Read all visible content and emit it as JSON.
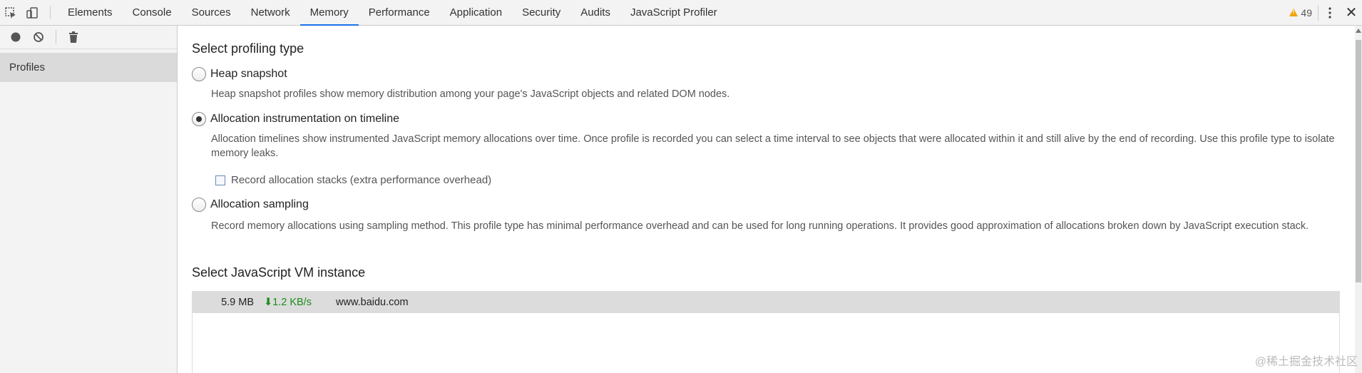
{
  "tabs": [
    "Elements",
    "Console",
    "Sources",
    "Network",
    "Memory",
    "Performance",
    "Application",
    "Security",
    "Audits",
    "JavaScript Profiler"
  ],
  "active_tab": "Memory",
  "warnings_count": "49",
  "sidebar": {
    "item": "Profiles"
  },
  "main": {
    "profiling_heading": "Select profiling type",
    "options": [
      {
        "label": "Heap snapshot",
        "desc": "Heap snapshot profiles show memory distribution among your page's JavaScript objects and related DOM nodes.",
        "selected": false
      },
      {
        "label": "Allocation instrumentation on timeline",
        "desc": "Allocation timelines show instrumented JavaScript memory allocations over time. Once profile is recorded you can select a time interval to see objects that were allocated within it and still alive by the end of recording. Use this profile type to isolate memory leaks.",
        "selected": true
      },
      {
        "label": "Allocation sampling",
        "desc": "Record memory allocations using sampling method. This profile type has minimal performance overhead and can be used for long running operations. It provides good approximation of allocations broken down by JavaScript execution stack.",
        "selected": false
      }
    ],
    "record_stacks_label": "Record allocation stacks (extra performance overhead)",
    "vm_heading": "Select JavaScript VM instance",
    "vm": {
      "size": "5.9 MB",
      "rate": "⬇1.2 KB/s",
      "host": "www.baidu.com"
    }
  },
  "watermark": "@稀土掘金技术社区",
  "colors": {
    "accent": "#1a73e8",
    "warning": "#f4a200",
    "rate_green": "#1a8c1a"
  }
}
